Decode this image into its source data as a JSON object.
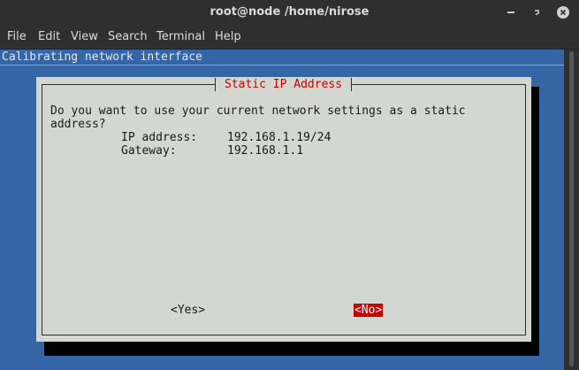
{
  "window": {
    "title": "root@node /home/nirose"
  },
  "menu": [
    "File",
    "Edit",
    "View",
    "Search",
    "Terminal",
    "Help"
  ],
  "terminal": {
    "backtitle": "Calibrating network interface"
  },
  "dialog": {
    "title": "Static IP Address",
    "question_line1": "Do you want to use your current network settings as a static",
    "question_line2": "address?",
    "ip_label": "IP address:",
    "ip_value": "192.168.1.19/24",
    "gateway_label": "Gateway:",
    "gateway_value": "192.168.1.1",
    "yes_label": "<Yes>",
    "no_label": "<No>",
    "selected_button": "No"
  },
  "colors": {
    "terminal_bg": "#3465a4",
    "dialog_bg": "#d3d7cf",
    "accent_red": "#cc0000"
  }
}
